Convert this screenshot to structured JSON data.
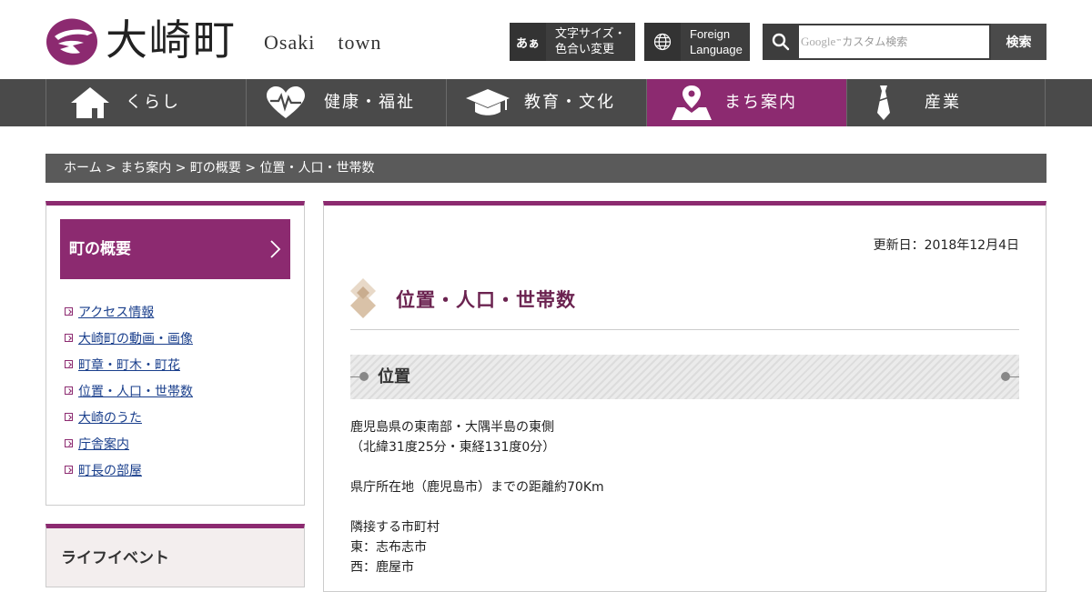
{
  "header": {
    "logo_jp": "大崎町",
    "logo_en": "Osaki  town",
    "font_button": {
      "icon_text": "あぁ",
      "line1": "文字サイズ・",
      "line2": "色合い変更"
    },
    "foreign_button": {
      "line1": "Foreign",
      "line2": "Language"
    },
    "search": {
      "google_word": "Google",
      "placeholder_suffix": "カスタム検索",
      "button_label": "検索"
    }
  },
  "nav": [
    {
      "label": "くらし",
      "icon": "house-icon"
    },
    {
      "label": "健康・福祉",
      "icon": "heartbeat-icon"
    },
    {
      "label": "教育・文化",
      "icon": "graduation-cap-icon"
    },
    {
      "label": "まち案内",
      "icon": "map-pin-icon",
      "active": true
    },
    {
      "label": "産業",
      "icon": "necktie-icon"
    }
  ],
  "breadcrumb": [
    "ホーム",
    "まち案内",
    "町の概要",
    "位置・人口・世帯数"
  ],
  "breadcrumb_sep": ">",
  "sidebar": {
    "title": "町の概要",
    "items": [
      "アクセス情報",
      "大崎町の動画・画像",
      "町章・町木・町花",
      "位置・人口・世帯数",
      "大崎のうた",
      "庁舎案内",
      "町長の部屋"
    ],
    "box2_title": "ライフイベント"
  },
  "main": {
    "updated": "更新日：2018年12月4日",
    "title": "位置・人口・世帯数",
    "section_title": "位置",
    "lines": [
      "鹿児島県の東南部・大隅半島の東側",
      "（北緯31度25分・東経131度0分）",
      "",
      "県庁所在地（鹿児島市）までの距離約70Km",
      "",
      "隣接する市町村",
      "東：志布志市",
      "西：鹿屋市"
    ]
  },
  "colors": {
    "accent": "#8c2a70",
    "nav_bg": "#4a4a4a",
    "title": "#6b2350"
  }
}
